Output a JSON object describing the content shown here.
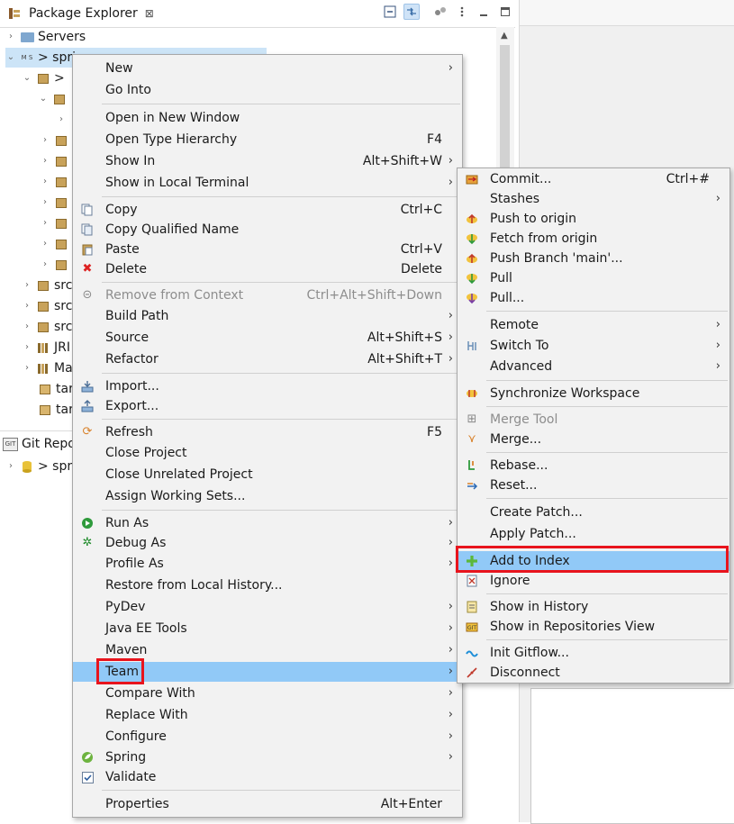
{
  "package_explorer": {
    "tab_label": "Package Explorer",
    "close_glyph": "⊠",
    "tree": [
      {
        "label": "Servers"
      },
      {
        "label": "> spri"
      },
      {
        "label": ">"
      },
      {
        "label": ""
      },
      {
        "label": ""
      },
      {
        "label": ""
      },
      {
        "label": ""
      },
      {
        "label": ""
      },
      {
        "label": ""
      },
      {
        "label": ""
      },
      {
        "label": ""
      },
      {
        "label": ""
      },
      {
        "label": "src"
      },
      {
        "label": "src"
      },
      {
        "label": "src"
      },
      {
        "label": "JRI"
      },
      {
        "label": "Ma"
      },
      {
        "label": "tar"
      },
      {
        "label": "tar"
      }
    ]
  },
  "git_repositories": {
    "tab_label": "Git Repo",
    "tree": [
      {
        "label": "> spri"
      }
    ]
  },
  "main_menu": {
    "items": [
      {
        "label": "New",
        "shortcut": "",
        "submenu": true
      },
      {
        "label": "Go Into",
        "shortcut": ""
      },
      {
        "label": "Open in New Window",
        "shortcut": ""
      },
      {
        "label": "Open Type Hierarchy",
        "shortcut": "F4"
      },
      {
        "label": "Show In",
        "shortcut": "Alt+Shift+W",
        "submenu": true
      },
      {
        "label": "Show in Local Terminal",
        "shortcut": "",
        "submenu": true
      },
      {
        "label": "Copy",
        "shortcut": "Ctrl+C",
        "icon": "copy-icon"
      },
      {
        "label": "Copy Qualified Name",
        "shortcut": "",
        "icon": "copy-qualified-icon"
      },
      {
        "label": "Paste",
        "shortcut": "Ctrl+V",
        "icon": "paste-icon"
      },
      {
        "label": "Delete",
        "shortcut": "Delete",
        "icon": "delete-icon"
      },
      {
        "label": "Remove from Context",
        "shortcut": "Ctrl+Alt+Shift+Down",
        "disabled": true,
        "icon": "remove-context-icon"
      },
      {
        "label": "Build Path",
        "shortcut": "",
        "submenu": true
      },
      {
        "label": "Source",
        "shortcut": "Alt+Shift+S",
        "submenu": true
      },
      {
        "label": "Refactor",
        "shortcut": "Alt+Shift+T",
        "submenu": true
      },
      {
        "label": "Import...",
        "shortcut": "",
        "icon": "import-icon"
      },
      {
        "label": "Export...",
        "shortcut": "",
        "icon": "export-icon"
      },
      {
        "label": "Refresh",
        "shortcut": "F5",
        "icon": "refresh-icon"
      },
      {
        "label": "Close Project",
        "shortcut": ""
      },
      {
        "label": "Close Unrelated Project",
        "shortcut": ""
      },
      {
        "label": "Assign Working Sets...",
        "shortcut": ""
      },
      {
        "label": "Run As",
        "shortcut": "",
        "submenu": true,
        "icon": "run-icon"
      },
      {
        "label": "Debug As",
        "shortcut": "",
        "submenu": true,
        "icon": "debug-icon"
      },
      {
        "label": "Profile As",
        "shortcut": "",
        "submenu": true
      },
      {
        "label": "Restore from Local History...",
        "shortcut": ""
      },
      {
        "label": "PyDev",
        "shortcut": "",
        "submenu": true
      },
      {
        "label": "Java EE Tools",
        "shortcut": "",
        "submenu": true
      },
      {
        "label": "Maven",
        "shortcut": "",
        "submenu": true
      },
      {
        "label": "Team",
        "shortcut": "",
        "submenu": true,
        "highlight": true
      },
      {
        "label": "Compare With",
        "shortcut": "",
        "submenu": true
      },
      {
        "label": "Replace With",
        "shortcut": "",
        "submenu": true
      },
      {
        "label": "Configure",
        "shortcut": "",
        "submenu": true
      },
      {
        "label": "Spring",
        "shortcut": "",
        "submenu": true,
        "icon": "spring-icon"
      },
      {
        "label": "Validate",
        "shortcut": "",
        "icon": "validate-checkbox-icon"
      },
      {
        "label": "Properties",
        "shortcut": "Alt+Enter"
      }
    ]
  },
  "team_menu": {
    "items": [
      {
        "label": "Commit...",
        "shortcut": "Ctrl+#",
        "icon": "commit-icon"
      },
      {
        "label": "Stashes",
        "shortcut": "",
        "submenu": true
      },
      {
        "label": "Push to origin",
        "shortcut": "",
        "icon": "push-icon"
      },
      {
        "label": "Fetch from origin",
        "shortcut": "",
        "icon": "fetch-icon"
      },
      {
        "label": "Push Branch 'main'...",
        "shortcut": "",
        "icon": "push-branch-icon"
      },
      {
        "label": "Pull",
        "shortcut": "",
        "icon": "pull-icon"
      },
      {
        "label": "Pull...",
        "shortcut": "",
        "icon": "pull-dialog-icon"
      },
      {
        "label": "Remote",
        "shortcut": "",
        "submenu": true
      },
      {
        "label": "Switch To",
        "shortcut": "",
        "submenu": true,
        "icon": "switch-branch-icon"
      },
      {
        "label": "Advanced",
        "shortcut": "",
        "submenu": true
      },
      {
        "label": "Synchronize Workspace",
        "shortcut": "",
        "icon": "synchronize-icon"
      },
      {
        "label": "Merge Tool",
        "shortcut": "",
        "disabled": true,
        "icon": "merge-tool-icon"
      },
      {
        "label": "Merge...",
        "shortcut": "",
        "icon": "merge-icon"
      },
      {
        "label": "Rebase...",
        "shortcut": "",
        "icon": "rebase-icon"
      },
      {
        "label": "Reset...",
        "shortcut": "",
        "icon": "reset-icon"
      },
      {
        "label": "Create Patch...",
        "shortcut": ""
      },
      {
        "label": "Apply Patch...",
        "shortcut": ""
      },
      {
        "label": "Add to Index",
        "shortcut": "",
        "highlight": true,
        "icon": "add-to-index-icon"
      },
      {
        "label": "Ignore",
        "shortcut": "",
        "icon": "ignore-icon"
      },
      {
        "label": "Show in History",
        "shortcut": "",
        "icon": "history-icon"
      },
      {
        "label": "Show in Repositories View",
        "shortcut": "",
        "icon": "repositories-view-icon"
      },
      {
        "label": "Init Gitflow...",
        "shortcut": "",
        "icon": "gitflow-icon"
      },
      {
        "label": "Disconnect",
        "shortcut": "",
        "icon": "disconnect-icon"
      }
    ]
  },
  "colors": {
    "menu_background": "#f2f2f2",
    "highlight": "#91c9f7",
    "annotation_box": "#e8141d",
    "selection": "#cce4f7"
  }
}
